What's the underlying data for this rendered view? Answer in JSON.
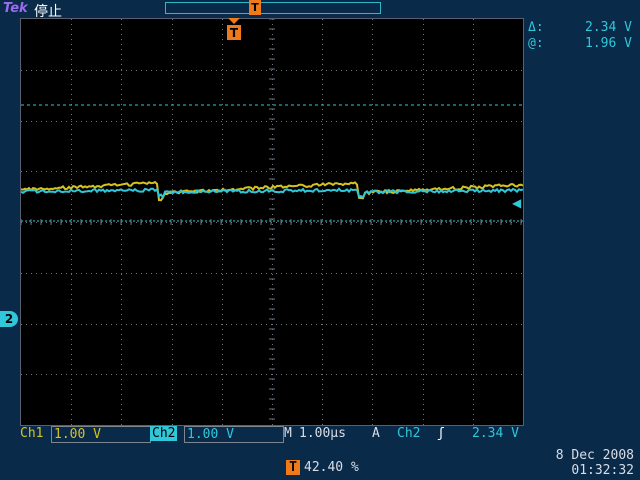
{
  "header": {
    "brand": "Tek",
    "run_state": "停止",
    "trigger_marker_label": "T"
  },
  "readouts": {
    "delta_symbol": "Δ:",
    "delta_value": "2.34 V",
    "at_symbol": "@:",
    "at_value": "1.96 V"
  },
  "markers": {
    "ch2_label": "2",
    "trigger_pos_label": "T"
  },
  "bottom": {
    "ch1_label": "Ch1",
    "ch1_scale": "1.00 V",
    "ch2_label": "Ch2",
    "ch2_scale": "1.00 V",
    "timebase_label": "M",
    "timebase_value": "1.00µs",
    "trigger_mode": "A",
    "trigger_source": "Ch2",
    "trigger_slope": "ʃ",
    "trigger_level": "2.34 V",
    "date": "8 Dec 2008",
    "time": "01:32:32",
    "trigger_pct_icon": "T",
    "trigger_pct": "42.40 %"
  },
  "colors": {
    "ch1": "#d6c21f",
    "ch2": "#2fc7d9",
    "trigger": "#f07a1a",
    "grid": "#6c7480"
  }
}
